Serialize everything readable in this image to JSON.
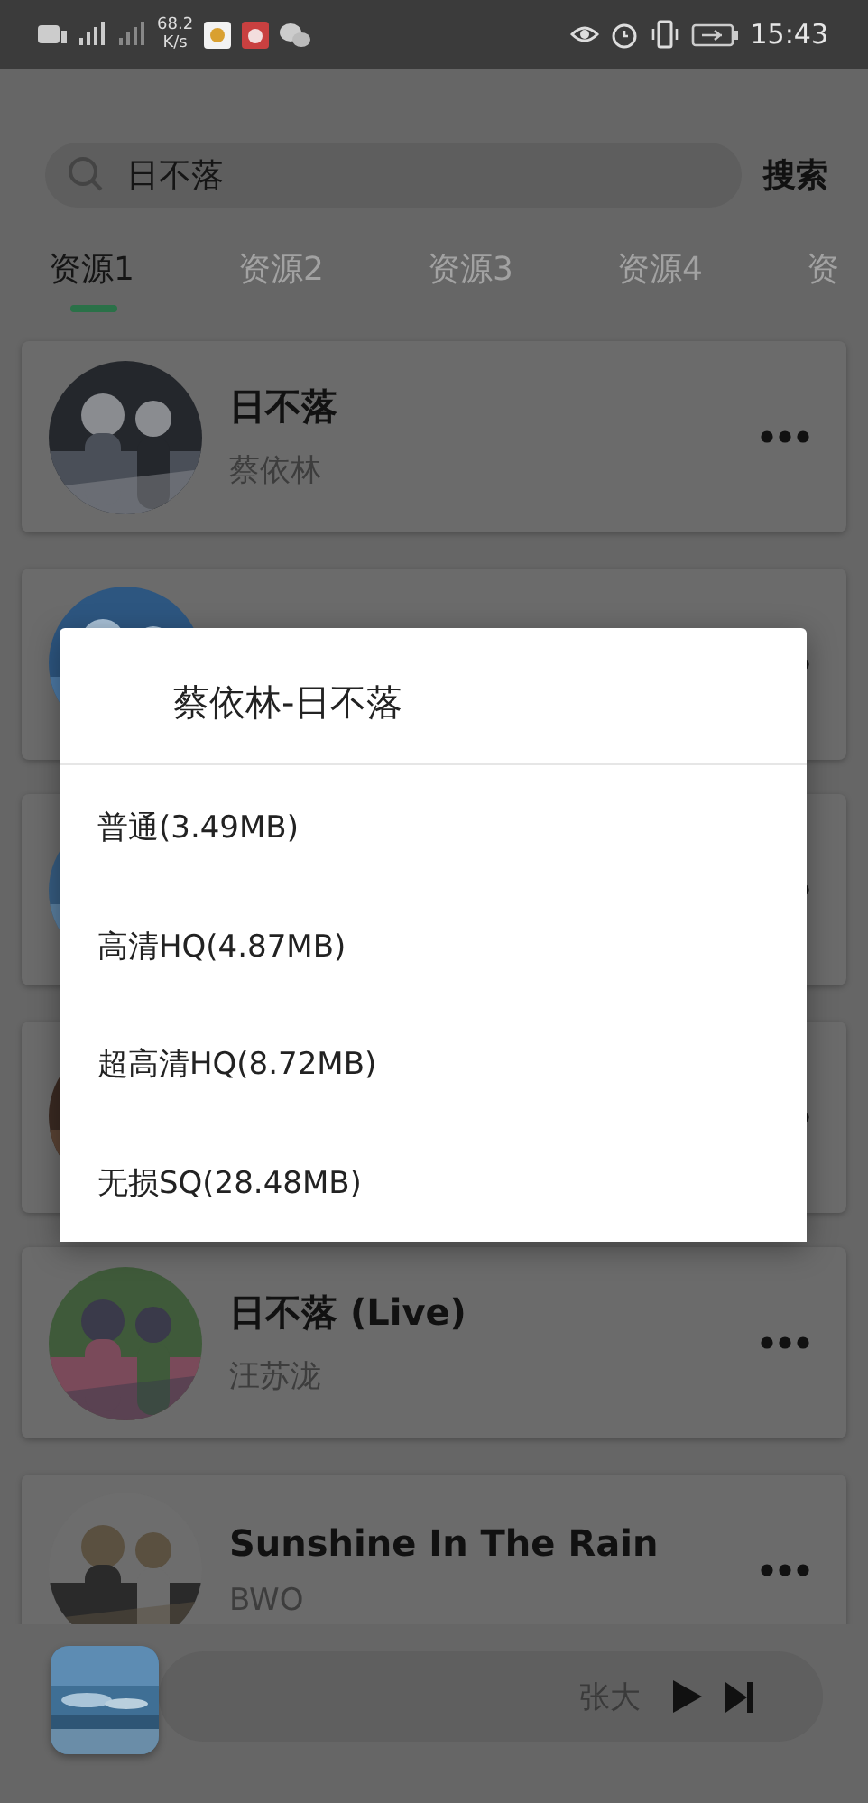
{
  "status_bar": {
    "speed": "68.2",
    "speed_unit": "K/s",
    "time": "15:43"
  },
  "search": {
    "value": "日不落",
    "button": "搜索"
  },
  "tabs": [
    {
      "label": "资源1",
      "selected": true
    },
    {
      "label": "资源2",
      "selected": false
    },
    {
      "label": "资源3",
      "selected": false
    },
    {
      "label": "资源4",
      "selected": false
    },
    {
      "label": "资",
      "selected": false
    }
  ],
  "songs": [
    {
      "kind": "full",
      "title": "日不落",
      "artist": "蔡依林"
    },
    {
      "kind": "covered"
    },
    {
      "kind": "covered"
    },
    {
      "kind": "covered"
    },
    {
      "kind": "full",
      "title": "日不落 (Live)",
      "artist": "汪苏泷"
    },
    {
      "kind": "full",
      "title": "Sunshine In The Rain",
      "artist": "BWO"
    }
  ],
  "player": {
    "text": "张大"
  },
  "dialog": {
    "title": "蔡依林-日不落",
    "options": [
      "普通(3.49MB)",
      "高清HQ(4.87MB)",
      "超高清HQ(8.72MB)",
      "无损SQ(28.48MB)"
    ]
  }
}
